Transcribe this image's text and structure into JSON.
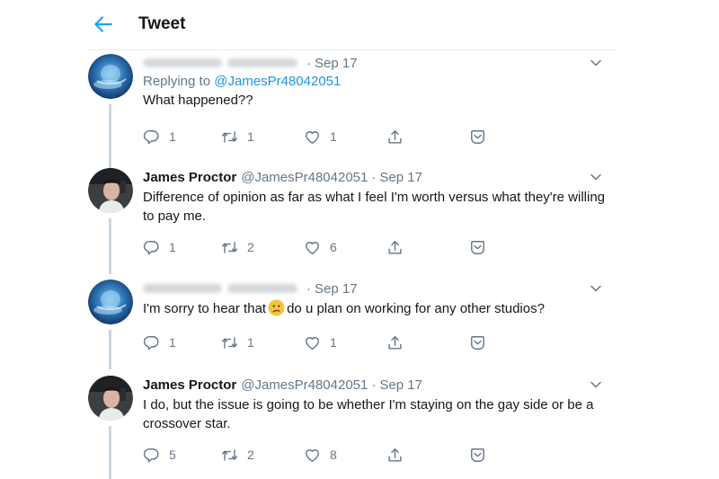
{
  "header": {
    "title": "Tweet"
  },
  "colors": {
    "accent": "#1da1f2",
    "secondary_text": "#657786",
    "thread_line": "#ccd6dd"
  },
  "tweets": [
    {
      "date": "Sep 17",
      "replying_prefix": "Replying to ",
      "replying_to": "@JamesPr48042051",
      "text": "What happened??",
      "replies": "1",
      "retweets": "1",
      "likes": "1"
    },
    {
      "name": "James Proctor",
      "handle": "@JamesPr48042051",
      "date": "Sep 17",
      "text": "Difference of opinion as far as what I feel I'm worth versus what they're willing to pay me.",
      "replies": "1",
      "retweets": "2",
      "likes": "6"
    },
    {
      "date": "Sep 17",
      "text_before": "I'm sorry to hear that",
      "emoji": "confused-face-emoji",
      "text_after": "do u plan on working for any other studios?",
      "replies": "1",
      "retweets": "1",
      "likes": "1"
    },
    {
      "name": "James Proctor",
      "handle": "@JamesPr48042051",
      "date": "Sep 17",
      "text": "I do, but the issue is going to be whether I'm staying on the gay side or be a crossover star.",
      "replies": "5",
      "retweets": "2",
      "likes": "8"
    }
  ]
}
